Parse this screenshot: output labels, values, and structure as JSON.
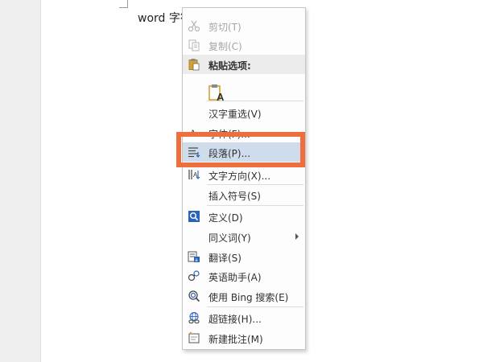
{
  "document": {
    "text": "word 字符"
  },
  "context_menu": {
    "items": [
      {
        "label": "剪切(T)",
        "icon": "scissors-icon",
        "state": "disabled"
      },
      {
        "label": "复制(C)",
        "icon": "copy-icon",
        "state": "disabled"
      },
      {
        "label": "粘贴选项:",
        "icon": "clipboard-icon",
        "state": "header"
      },
      {
        "label": "",
        "icon": "paste-keep-text-icon",
        "state": "paste-option"
      },
      {
        "label": "汉字重选(V)",
        "icon": "",
        "state": "normal"
      },
      {
        "label": "字体(F)...",
        "icon": "font-icon",
        "state": "normal"
      },
      {
        "label": "段落(P)...",
        "icon": "paragraph-icon",
        "state": "selected"
      },
      {
        "label": "文字方向(X)...",
        "icon": "text-direction-icon",
        "state": "normal"
      },
      {
        "label": "插入符号(S)",
        "icon": "",
        "state": "normal"
      },
      {
        "label": "定义(D)",
        "icon": "define-icon",
        "state": "normal"
      },
      {
        "label": "同义词(Y)",
        "icon": "",
        "state": "submenu"
      },
      {
        "label": "翻译(S)",
        "icon": "translate-icon",
        "state": "normal"
      },
      {
        "label": "英语助手(A)",
        "icon": "english-assistant-icon",
        "state": "normal"
      },
      {
        "label": "使用 Bing 搜索(E)",
        "icon": "search-icon",
        "state": "normal"
      },
      {
        "label": "超链接(H)...",
        "icon": "hyperlink-icon",
        "state": "normal"
      },
      {
        "label": "新建批注(M)",
        "icon": "new-comment-icon",
        "state": "normal"
      }
    ]
  },
  "colors": {
    "highlight_border": "#ee6f3d",
    "selected_background": "#cfdcec",
    "accent_blue": "#2b63b8",
    "accent_gold": "#d5a32d"
  }
}
